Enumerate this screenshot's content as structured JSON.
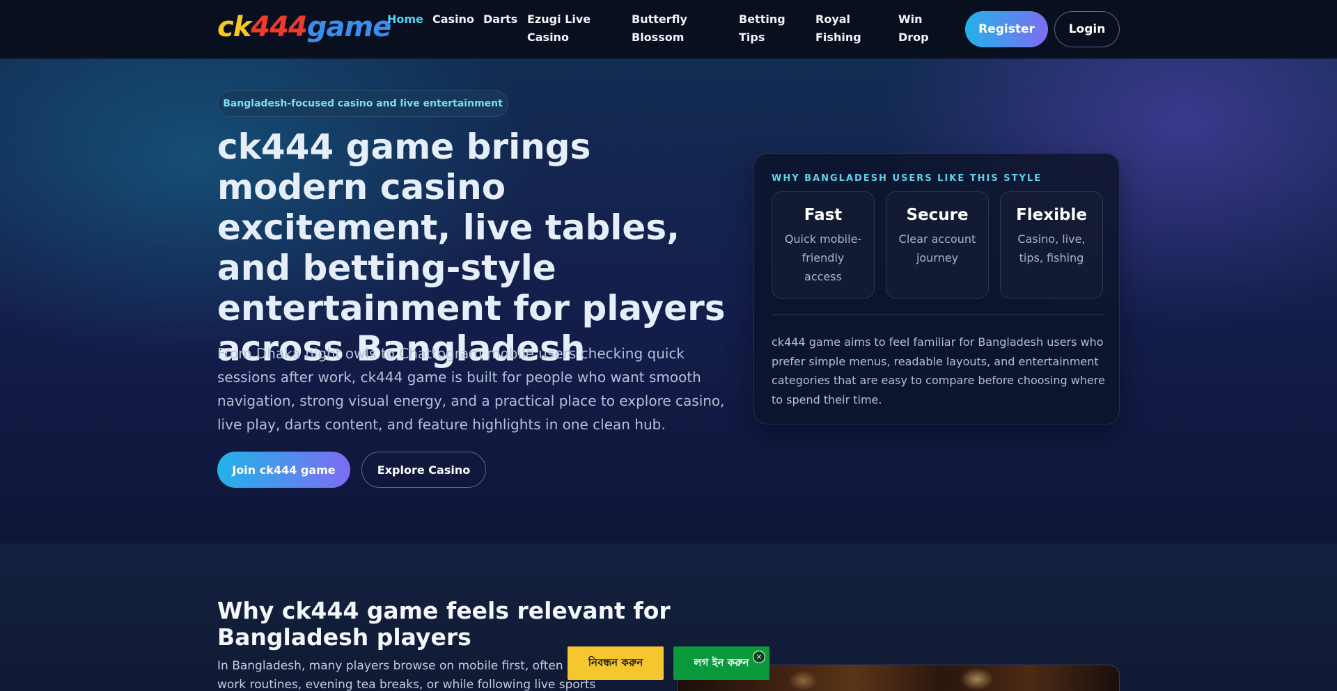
{
  "header": {
    "logo": {
      "part1": "ck",
      "part2": "444",
      "part3": "game"
    },
    "nav": [
      {
        "label": "Home",
        "active": true
      },
      {
        "label": "Casino"
      },
      {
        "label": "Darts"
      },
      {
        "label": "Ezugi Live Casino"
      },
      {
        "label": "Butterfly Blossom"
      },
      {
        "label": "Betting Tips"
      },
      {
        "label": "Royal Fishing"
      },
      {
        "label": "Win Drop"
      }
    ],
    "register_label": "Register",
    "login_label": "Login"
  },
  "hero": {
    "badge": "Bangladesh-focused casino and live entertainment",
    "title": "ck444 game brings modern casino excitement, live tables, and betting-style entertainment for players across Bangladesh",
    "description": "From Dhaka night owls to Chattogram mobile users checking quick sessions after work, ck444 game is built for people who want smooth navigation, strong visual energy, and a practical place to explore casino, live play, darts content, and feature highlights in one clean hub.",
    "join_label": "Join ck444 game",
    "explore_label": "Explore Casino"
  },
  "card": {
    "eyebrow": "WHY BANGLADESH USERS LIKE THIS STYLE",
    "stats": [
      {
        "title": "Fast",
        "sub": "Quick mobile-friendly access"
      },
      {
        "title": "Secure",
        "sub": "Clear account journey"
      },
      {
        "title": "Flexible",
        "sub": "Casino, live, tips, fishing"
      }
    ],
    "text": "ck444 game aims to feel familiar for Bangladesh users who prefer simple menus, readable layouts, and entertainment categories that are easy to compare before choosing where to spend their time."
  },
  "section2": {
    "title": "Why ck444 game feels relevant for Bangladesh players",
    "text": "In Bangladesh, many players browse on mobile first, often between work routines, evening tea breaks, or while following live sports updates with"
  },
  "sticky": {
    "register_label": "নিবন্ধন করুন",
    "login_label": "লগ ইন করুন",
    "close_label": "×"
  },
  "colors": {
    "accent_cyan": "#4ed6f2",
    "gradient_start": "#22b2e8",
    "gradient_end": "#7d6df2",
    "sticky_yellow": "#f6c62e",
    "sticky_green": "#0a9a3c"
  }
}
